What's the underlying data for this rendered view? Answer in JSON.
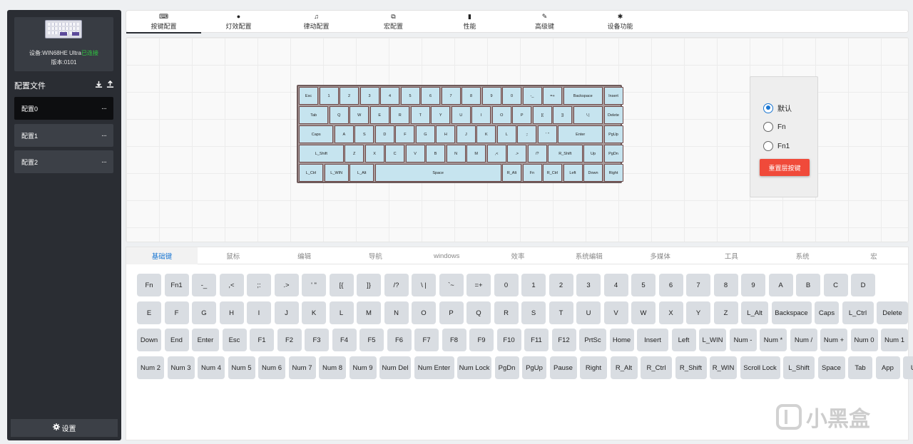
{
  "sidebar": {
    "device_prefix": "设备:WIN68HE Ultra",
    "device_status": "已连接",
    "version": "版本:0101",
    "profiles_title": "配置文件",
    "download_icon": "download-icon",
    "upload_icon": "upload-icon",
    "profiles": [
      {
        "label": "配置0",
        "menu": "···"
      },
      {
        "label": "配置1",
        "menu": "···"
      },
      {
        "label": "配置2",
        "menu": "···"
      }
    ],
    "settings_label": "设置",
    "settings_icon": "gear-icon"
  },
  "top_tabs": [
    {
      "icon": "⌨",
      "label": "按键配置"
    },
    {
      "icon": "●",
      "label": "灯效配置"
    },
    {
      "icon": "♫",
      "label": "律动配置"
    },
    {
      "icon": "⧉",
      "label": "宏配置"
    },
    {
      "icon": "▮",
      "label": "性能"
    },
    {
      "icon": "✎",
      "label": "高级键"
    },
    {
      "icon": "✱",
      "label": "设备功能"
    }
  ],
  "keyboard_rows": [
    [
      "Esc",
      "1",
      "2",
      "3",
      "4",
      "5",
      "6",
      "7",
      "8",
      "9",
      "0",
      "-_",
      "=+",
      "Backspace",
      "Insert"
    ],
    [
      "Tab",
      "Q",
      "W",
      "E",
      "R",
      "T",
      "Y",
      "U",
      "I",
      "O",
      "P",
      "[{",
      "]}",
      "\\ |",
      "Delete"
    ],
    [
      "Caps",
      "A",
      "S",
      "D",
      "F",
      "G",
      "H",
      "J",
      "K",
      "L",
      ";:",
      "' \"",
      "Enter",
      "PgUp"
    ],
    [
      "L_Shift",
      "Z",
      "X",
      "C",
      "V",
      "B",
      "N",
      "M",
      ",<",
      ".>",
      "/?",
      "R_Shift",
      "Up",
      "PgDn"
    ],
    [
      "L_Ctrl",
      "L_WIN",
      "L_Alt",
      "Space",
      "R_Alt",
      "Fn",
      "R_Ctrl",
      "Left",
      "Down",
      "Right"
    ]
  ],
  "layers": {
    "options": [
      "默认",
      "Fn",
      "Fn1"
    ],
    "selected": 0,
    "reset_label": "重置层按键"
  },
  "categories": [
    "基础键",
    "鼠标",
    "编辑",
    "导航",
    "windows",
    "效率",
    "系统编辑",
    "多媒体",
    "工具",
    "系统",
    "宏"
  ],
  "active_category": 0,
  "palette_rows": [
    [
      "Fn",
      "Fn1",
      "-_",
      ",<",
      ";:",
      ".>",
      "' \"",
      "[{",
      "]}",
      "/?",
      "\\ |",
      "`~",
      "=+",
      "0",
      "1",
      "2",
      "3",
      "4",
      "5",
      "6",
      "7",
      "8",
      "9",
      "A",
      "B",
      "C",
      "D"
    ],
    [
      "E",
      "F",
      "G",
      "H",
      "I",
      "J",
      "K",
      "L",
      "M",
      "N",
      "O",
      "P",
      "Q",
      "R",
      "S",
      "T",
      "U",
      "V",
      "W",
      "X",
      "Y",
      "Z",
      "L_Alt",
      "Backspace",
      "Caps",
      "L_Ctrl",
      "Delete"
    ],
    [
      "Down",
      "End",
      "Enter",
      "Esc",
      "F1",
      "F2",
      "F3",
      "F4",
      "F5",
      "F6",
      "F7",
      "F8",
      "F9",
      "F10",
      "F11",
      "F12",
      "PrtSc",
      "Home",
      "Insert",
      "Left",
      "L_WIN",
      "Num -",
      "Num *",
      "Num /",
      "Num +",
      "Num 0",
      "Num 1"
    ],
    [
      "Num 2",
      "Num 3",
      "Num 4",
      "Num 5",
      "Num 6",
      "Num 7",
      "Num 8",
      "Num 9",
      "Num Del",
      "Num Enter",
      "Num Lock",
      "PgDn",
      "PgUp",
      "Pause",
      "Right",
      "R_Alt",
      "R_Ctrl",
      "R_Shift",
      "R_WIN",
      "Scroll Lock",
      "L_Shift",
      "Space",
      "Tab",
      "App",
      "Up"
    ]
  ],
  "watermark": "小黑盒"
}
